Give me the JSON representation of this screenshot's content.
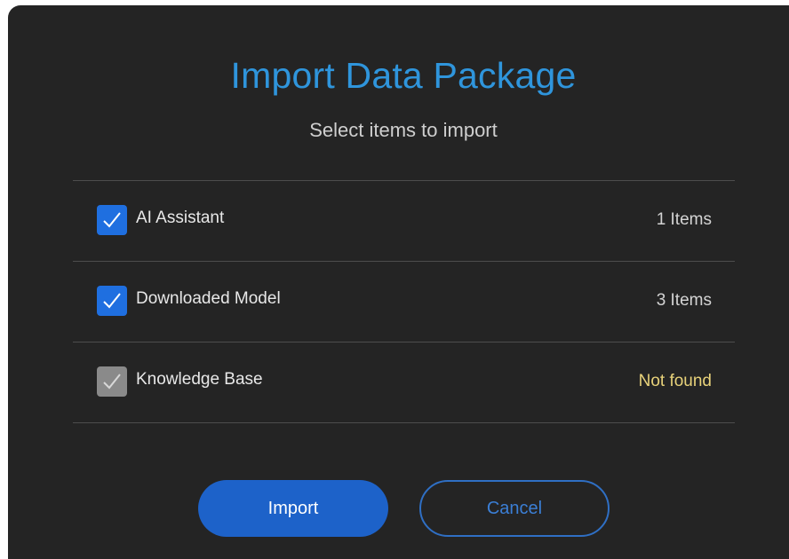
{
  "dialog": {
    "title": "Import Data Package",
    "subtitle": "Select items to import",
    "items": [
      {
        "label": "AI Assistant",
        "count": "1 Items",
        "checked": true,
        "enabled": true
      },
      {
        "label": "Downloaded Model",
        "count": "3 Items",
        "checked": true,
        "enabled": true
      },
      {
        "label": "Knowledge Base",
        "count": "Not found",
        "checked": true,
        "enabled": false
      }
    ],
    "import_label": "Import",
    "cancel_label": "Cancel"
  },
  "colors": {
    "background": "#242424",
    "title": "#2f95dc",
    "checkbox_active": "#1f6fe0",
    "checkbox_disabled": "#8a8a8a",
    "not_found": "#e8d27a",
    "primary_button": "#1d62c9"
  },
  "icons": {
    "checkbox": "checkmark-icon"
  }
}
